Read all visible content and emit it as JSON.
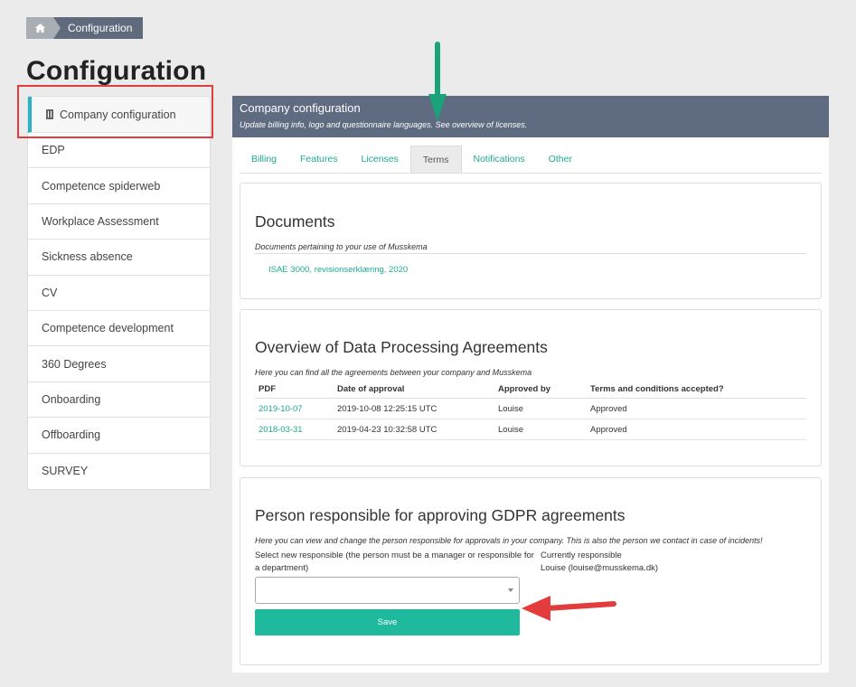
{
  "breadcrumb": {
    "home_icon": "home-icon",
    "current": "Configuration"
  },
  "page": {
    "title": "Configuration"
  },
  "sidebar": {
    "items": [
      {
        "label": "Company configuration",
        "icon": "building-icon",
        "active": true
      },
      {
        "label": "EDP"
      },
      {
        "label": "Competence spiderweb"
      },
      {
        "label": "Workplace Assessment"
      },
      {
        "label": "Sickness absence"
      },
      {
        "label": "CV"
      },
      {
        "label": "Competence development"
      },
      {
        "label": "360 Degrees"
      },
      {
        "label": "Onboarding"
      },
      {
        "label": "Offboarding"
      },
      {
        "label": "SURVEY"
      }
    ]
  },
  "panel": {
    "title": "Company configuration",
    "subtitle": "Update billing info, logo and questionnaire languages. See overview of licenses."
  },
  "tabs": [
    "Billing",
    "Features",
    "Licenses",
    "Terms",
    "Notifications",
    "Other"
  ],
  "active_tab": "Terms",
  "documents": {
    "heading": "Documents",
    "description": "Documents pertaining to your use of Musskema",
    "link": "ISAE 3000, revisionserklæring, 2020"
  },
  "dpa": {
    "heading": "Overview of Data Processing Agreements",
    "description": "Here you can find all the agreements between your company and Musskema",
    "columns": [
      "PDF",
      "Date of approval",
      "Approved by",
      "Terms and conditions accepted?"
    ],
    "rows": [
      [
        "2019-10-07",
        "2019-10-08 12:25:15 UTC",
        "Louise",
        "Approved"
      ],
      [
        "2018-03-31",
        "2019-04-23 10:32:58 UTC",
        "Louise",
        "Approved"
      ]
    ]
  },
  "gdpr": {
    "heading": "Person responsible for approving GDPR agreements",
    "description": "Here you can view and change the person responsible for approvals in your company. This is also the person we contact in case of incidents!",
    "select_label": "Select new responsible (the person must be a manager or responsible for a department)",
    "current_label": "Currently responsible",
    "current_value": "Louise (louise@musskema.dk)",
    "select_value": "",
    "save_label": "Save"
  },
  "colors": {
    "accent": "#1fba9e",
    "panel_header": "#5e6b80",
    "annotation_red": "#e23c3c",
    "annotation_green": "#1aa37a"
  }
}
